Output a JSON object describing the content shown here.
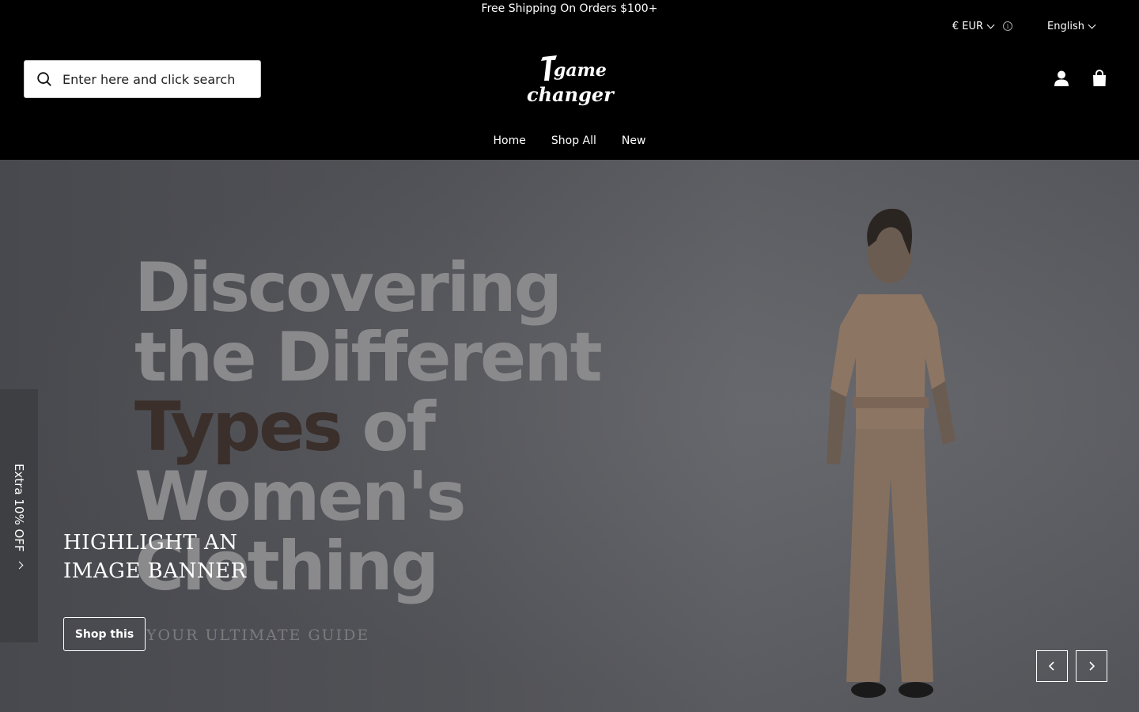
{
  "announcement": "Free Shipping On Orders $100+",
  "utility": {
    "currency": "€ EUR",
    "info_icon": "info-icon",
    "language": "English"
  },
  "search": {
    "placeholder": "Enter here and click search",
    "icon": "search-icon"
  },
  "logo": {
    "alt": "game changer",
    "line1": "game",
    "line2": "changer"
  },
  "header_icons": [
    "account-icon",
    "cart-icon"
  ],
  "nav": {
    "items": [
      {
        "label": "Home"
      },
      {
        "label": "Shop All"
      },
      {
        "label": "New"
      }
    ]
  },
  "hero": {
    "poster_lines": [
      "Discovering",
      "the Different",
      "Types",
      "of",
      "Women's",
      "Clothing"
    ],
    "poster_subtitle": "YOUR ULTIMATE GUIDE",
    "title_line1": "HIGHLIGHT AN",
    "title_line2": "IMAGE BANNER",
    "cta": "Shop this",
    "side_tab": "Extra 10% OFF",
    "prev_icon": "chevron-left-icon",
    "next_icon": "chevron-right-icon"
  },
  "colors": {
    "header_bg": "#000000",
    "hero_bg": "#55565b",
    "poster_text": "#8a8a8c",
    "poster_accent": "#3a2f2a",
    "outfit": "#8c7563"
  }
}
